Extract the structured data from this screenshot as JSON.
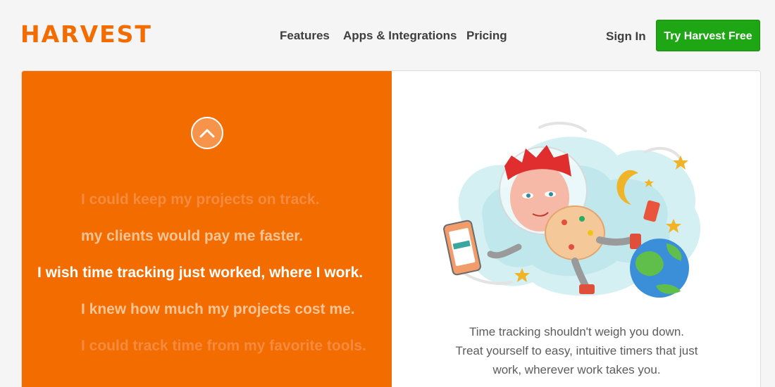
{
  "header": {
    "logo": "HARVEST",
    "nav": [
      "Features",
      "Apps & Integrations",
      "Pricing"
    ],
    "sign_in": "Sign In",
    "cta": "Try Harvest Free"
  },
  "hero": {
    "carousel_lines": [
      "I could keep my projects on track.",
      "my clients would pay me faster.",
      "I wish time tracking just worked, where I work.",
      "I knew how much my projects cost me.",
      "I could track time from my favorite tools."
    ],
    "active_index": 2,
    "tagline": [
      "Time tracking shouldn't weigh you down.",
      "Treat yourself to easy, intuitive timers that just",
      "work, wherever work takes you."
    ]
  },
  "colors": {
    "brand_orange": "#f36c00",
    "cta_green": "#1ea614",
    "nav_text": "#3e3e3e"
  }
}
